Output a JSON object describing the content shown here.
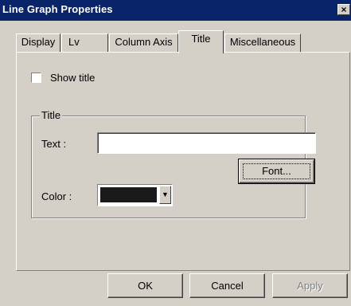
{
  "window": {
    "title": "Line Graph Properties",
    "close_glyph": "×"
  },
  "tabs": [
    {
      "label": "Display",
      "active": false
    },
    {
      "label": "Lv",
      "active": false
    },
    {
      "label": "Column Axis",
      "active": false
    },
    {
      "label": "Title",
      "active": true
    },
    {
      "label": "Miscellaneous",
      "active": false
    }
  ],
  "panel": {
    "show_title": {
      "label": "Show title",
      "checked": false
    },
    "group": {
      "legend": "Title",
      "text_label": "Text :",
      "text_value": "",
      "font_button": "Font...",
      "color_label": "Color :",
      "color_value": "#1a1a1a",
      "color_arrow": "▼"
    }
  },
  "buttons": {
    "ok": "OK",
    "cancel": "Cancel",
    "apply": "Apply"
  },
  "colors": {
    "titlebar": "#0a246a",
    "face": "#d4d0c8"
  }
}
